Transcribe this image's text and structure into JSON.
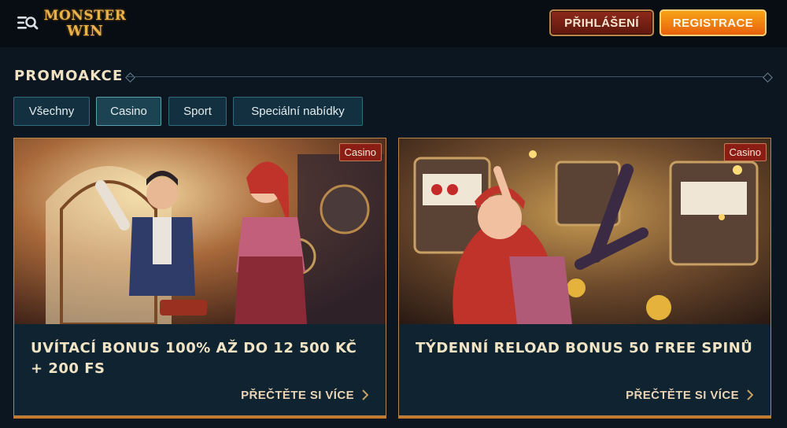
{
  "header": {
    "logo_line1": "MONSTER",
    "logo_line2": "WIN",
    "login_label": "PŘIHLÁŠENÍ",
    "register_label": "REGISTRACE"
  },
  "section": {
    "title": "PROMOAKCE"
  },
  "tabs": [
    {
      "label": "Všechny"
    },
    {
      "label": "Casino",
      "active": true
    },
    {
      "label": "Sport"
    },
    {
      "label": "Speciální nabídky"
    }
  ],
  "cards": [
    {
      "badge": "Casino",
      "title": "UVÍTACÍ BONUS 100% AŽ DO 12 500 KČ + 200 FS",
      "cta": "PŘEČTĚTE SI VÍCE"
    },
    {
      "badge": "Casino",
      "title": "TÝDENNÍ RELOAD BONUS 50 FREE SPINŮ",
      "cta": "PŘEČTĚTE SI VÍCE"
    }
  ],
  "colors": {
    "background": "#0c1620",
    "accent_gold": "#e9b24a",
    "login": "#8d2a1b",
    "register": "#f08a14",
    "badge": "#8b1e14"
  },
  "icons": [
    "menu-search-icon",
    "chevron-right-icon"
  ]
}
